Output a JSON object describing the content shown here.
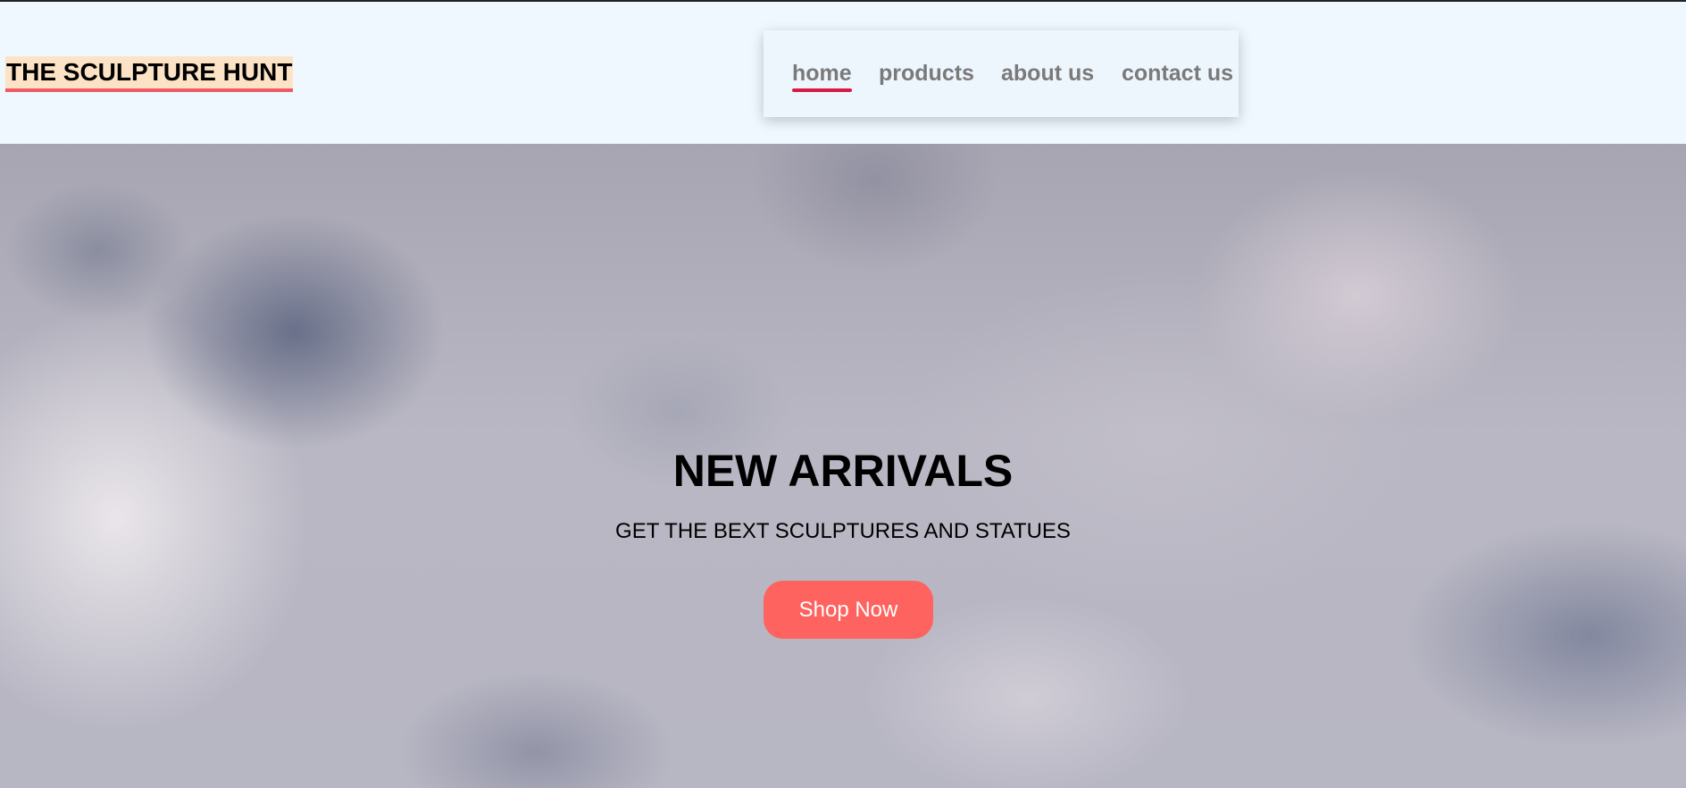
{
  "header": {
    "logo_text": "THE SCULPTURE HUNT",
    "nav": {
      "items": [
        {
          "label": "home",
          "active": true
        },
        {
          "label": "products",
          "active": false
        },
        {
          "label": "about us",
          "active": false
        },
        {
          "label": "contact us",
          "active": false
        }
      ]
    }
  },
  "hero": {
    "title": "NEW ARRIVALS",
    "subtitle": "GET THE BEXT SCULPTURES AND STATUES",
    "cta_label": "Shop Now"
  },
  "colors": {
    "header_bg": "#eff7ff",
    "logo_highlight": "#fde3c6",
    "logo_underline": "#ee5a63",
    "nav_active_underline": "#d91a45",
    "nav_text": "#7a7a7a",
    "cta_bg": "#fe635f",
    "cta_text": "#ffffff"
  }
}
